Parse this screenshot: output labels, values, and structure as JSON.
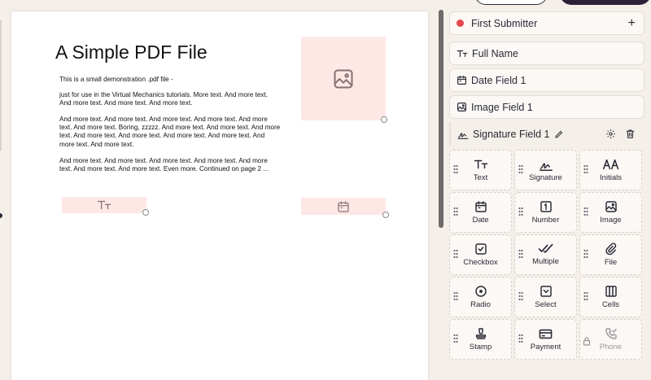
{
  "document": {
    "title": "A Simple PDF File",
    "paragraphs": [
      "This is a small demonstration .pdf file -",
      "just for use in the Virtual Mechanics tutorials. More text. And more text. And more text. And more text. And more text.",
      "And more text. And more text. And more text. And more text. And more text. And more text. Boring, zzzzz. And more text. And more text. And more text. And more text. And more text. And more text. And more text. And more text. And more text.",
      "And more text. And more text. And more text. And more text. And more text. And more text. And more text. Even more. Continued on page 2 ..."
    ]
  },
  "sidebar": {
    "submitter": {
      "label": "First Submitter",
      "add_icon": "plus-icon"
    },
    "fields": [
      {
        "label": "Full Name",
        "icon": "text-icon"
      },
      {
        "label": "Date Field 1",
        "icon": "calendar-icon"
      },
      {
        "label": "Image Field 1",
        "icon": "image-icon"
      },
      {
        "label": "Signature Field 1",
        "icon": "signature-icon"
      }
    ],
    "field_types": [
      {
        "label": "Text",
        "icon": "text-icon"
      },
      {
        "label": "Signature",
        "icon": "signature-icon"
      },
      {
        "label": "Initials",
        "icon": "initials-icon"
      },
      {
        "label": "Date",
        "icon": "calendar-icon"
      },
      {
        "label": "Number",
        "icon": "number-icon"
      },
      {
        "label": "Image",
        "icon": "image-icon"
      },
      {
        "label": "Checkbox",
        "icon": "checkbox-icon"
      },
      {
        "label": "Multiple",
        "icon": "multiple-check-icon"
      },
      {
        "label": "File",
        "icon": "paperclip-icon"
      },
      {
        "label": "Radio",
        "icon": "radio-icon"
      },
      {
        "label": "Select",
        "icon": "select-icon"
      },
      {
        "label": "Cells",
        "icon": "cells-icon"
      },
      {
        "label": "Stamp",
        "icon": "stamp-icon"
      },
      {
        "label": "Payment",
        "icon": "payment-icon"
      },
      {
        "label": "Phone",
        "icon": "phone-icon",
        "disabled": true
      }
    ]
  },
  "colors": {
    "accent_dot": "#e5484d",
    "field_fill": "#fde8e6",
    "panel_bg": "#f4efe9"
  }
}
